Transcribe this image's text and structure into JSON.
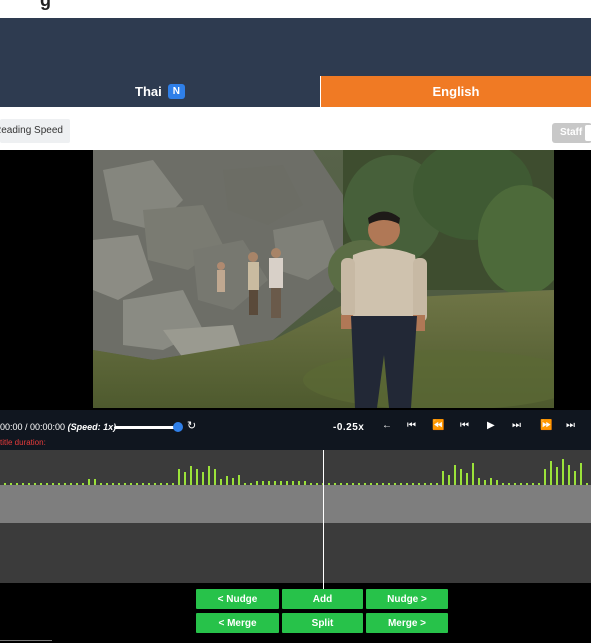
{
  "tabs": {
    "thai_label": "Thai",
    "thai_badge": "N",
    "english_label": "English"
  },
  "toolbar": {
    "reading_speed_label": "Reading Speed",
    "staff_label": "Staff"
  },
  "player": {
    "time": "00:00 / 00:00:00",
    "speed_text": "(Speed: 1x)",
    "duration_label": "title duration:",
    "offset": "-0.25x",
    "volume_level": 0.88
  },
  "controls": {
    "back_arrow": "←",
    "skip_start": "⏮",
    "rewind_fast": "⏪",
    "skip_prev": "⏮",
    "play": "▶",
    "skip_next": "⏭",
    "forward_fast": "⏩",
    "skip_end": "⏭",
    "reset": "↻"
  },
  "actions": {
    "nudge_left": "< Nudge",
    "add": "Add",
    "nudge_right": "Nudge >",
    "merge_left": "< Merge",
    "split": "Split",
    "merge_right": "Merge >"
  },
  "colors": {
    "header": "#2e3b50",
    "english_tab": "#f07a24",
    "badge": "#2f7fe8",
    "action_button": "#27c24a",
    "waveform_bar": "#9be23a",
    "duration_label": "#e53b3b"
  }
}
